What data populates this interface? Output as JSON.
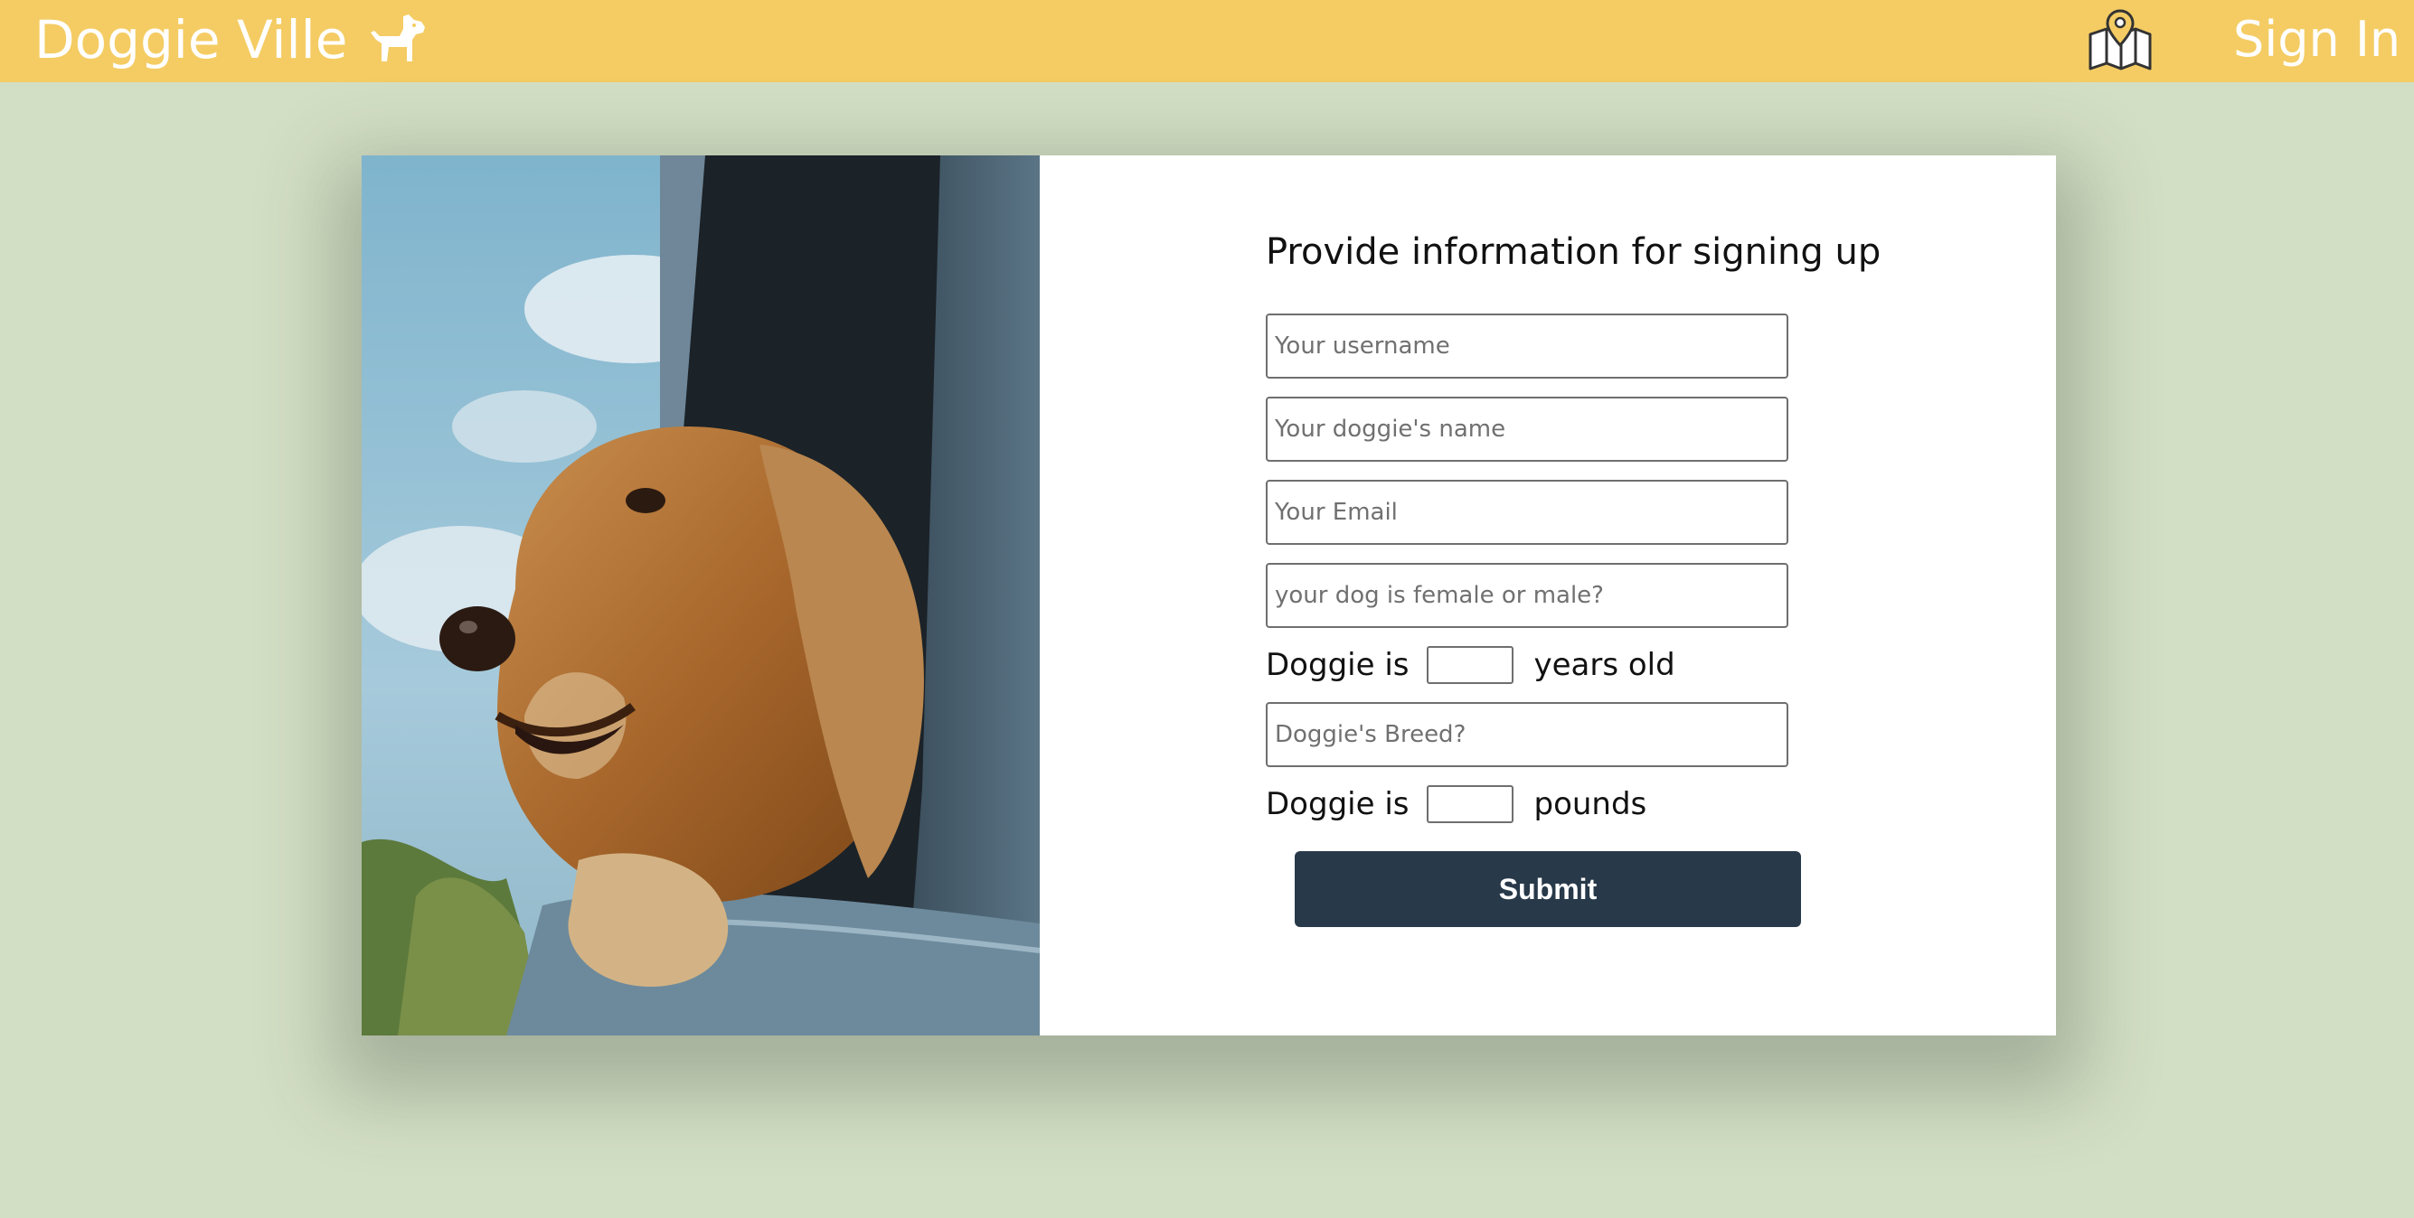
{
  "navbar": {
    "brand": "Doggie Ville",
    "brand_icon": "dog-icon",
    "map_icon": "map-pin-icon",
    "signin": "Sign In",
    "background": "#f4cc63"
  },
  "photo": {
    "alt": "Dog with head out of car window"
  },
  "form": {
    "title": "Provide information for signing up",
    "username_placeholder": "Your username",
    "dogname_placeholder": "Your doggie's name",
    "email_placeholder": "Your Email",
    "gender_placeholder": "your dog is female or male?",
    "age_prefix": "Doggie is",
    "age_suffix": "years old",
    "breed_placeholder": "Doggie's Breed?",
    "weight_prefix": "Doggie is",
    "weight_suffix": "pounds",
    "submit": "Submit"
  },
  "colors": {
    "page_background": "#d3dfc4",
    "submit_background": "#28394a"
  }
}
